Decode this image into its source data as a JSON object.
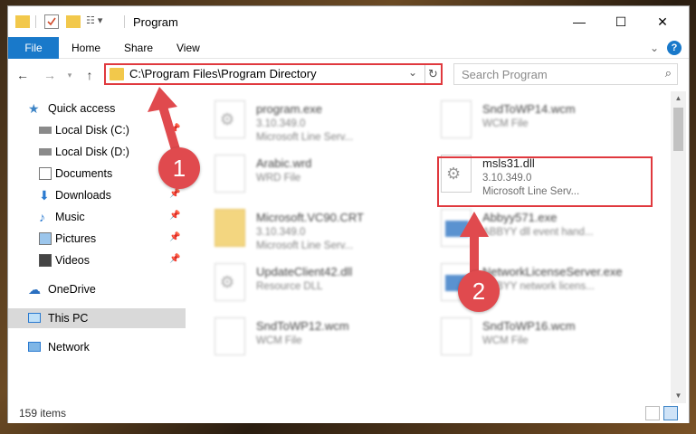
{
  "window": {
    "title": "Program",
    "controls": {
      "minimize": "—",
      "maximize": "☐",
      "close": "✕"
    }
  },
  "ribbon": {
    "tabs": [
      "File",
      "Home",
      "Share",
      "View"
    ],
    "expand_icon": "chevron-down-icon",
    "help_icon": "?"
  },
  "address": {
    "path": "C:\\Program Files\\Program Directory",
    "search_placeholder": "Search Program"
  },
  "sidebar": {
    "items": [
      {
        "label": "Quick access",
        "icon": "star-icon",
        "pinned": false
      },
      {
        "label": "Local Disk (C:)",
        "icon": "drive-icon",
        "pinned": true
      },
      {
        "label": "Local Disk (D:)",
        "icon": "drive-icon",
        "pinned": false
      },
      {
        "label": "Documents",
        "icon": "documents-icon",
        "pinned": true
      },
      {
        "label": "Downloads",
        "icon": "download-icon",
        "pinned": true
      },
      {
        "label": "Music",
        "icon": "music-icon",
        "pinned": true
      },
      {
        "label": "Pictures",
        "icon": "pictures-icon",
        "pinned": true
      },
      {
        "label": "Videos",
        "icon": "videos-icon",
        "pinned": true
      },
      {
        "label": "OneDrive",
        "icon": "cloud-icon",
        "pinned": false
      },
      {
        "label": "This PC",
        "icon": "computer-icon",
        "pinned": false,
        "selected": true
      },
      {
        "label": "Network",
        "icon": "network-icon",
        "pinned": false
      }
    ]
  },
  "files": [
    {
      "name": "program.exe",
      "line1": "3.10.349.0",
      "line2": "Microsoft Line Serv...",
      "type": "gear",
      "blurred": true
    },
    {
      "name": "SndToWP14.wcm",
      "line1": "WCM File",
      "line2": "",
      "type": "doc",
      "blurred": true
    },
    {
      "name": "Arabic.wrd",
      "line1": "WRD File",
      "line2": "",
      "type": "doc",
      "blurred": true
    },
    {
      "name": "msls31.dll",
      "line1": "3.10.349.0",
      "line2": "Microsoft Line Serv...",
      "type": "gear",
      "blurred": false
    },
    {
      "name": "Microsoft.VC90.CRT",
      "line1": "3.10.349.0",
      "line2": "Microsoft Line Serv...",
      "type": "folder",
      "blurred": true
    },
    {
      "name": "Abbyy571.exe",
      "line1": "ABBYY dll event hand...",
      "line2": "",
      "type": "app",
      "blurred": true
    },
    {
      "name": "UpdateClient42.dll",
      "line1": "Resource DLL",
      "line2": "",
      "type": "gear",
      "blurred": true
    },
    {
      "name": "NetworkLicenseServer.exe",
      "line1": "ABBYY network licens...",
      "line2": "",
      "type": "app",
      "blurred": true
    },
    {
      "name": "SndToWP12.wcm",
      "line1": "WCM File",
      "line2": "",
      "type": "doc",
      "blurred": true
    },
    {
      "name": "SndToWP16.wcm",
      "line1": "WCM File",
      "line2": "",
      "type": "doc",
      "blurred": true
    }
  ],
  "status": {
    "count": "159 items"
  },
  "annotations": {
    "badge1": "1",
    "badge2": "2",
    "accent": "#e0393e"
  }
}
